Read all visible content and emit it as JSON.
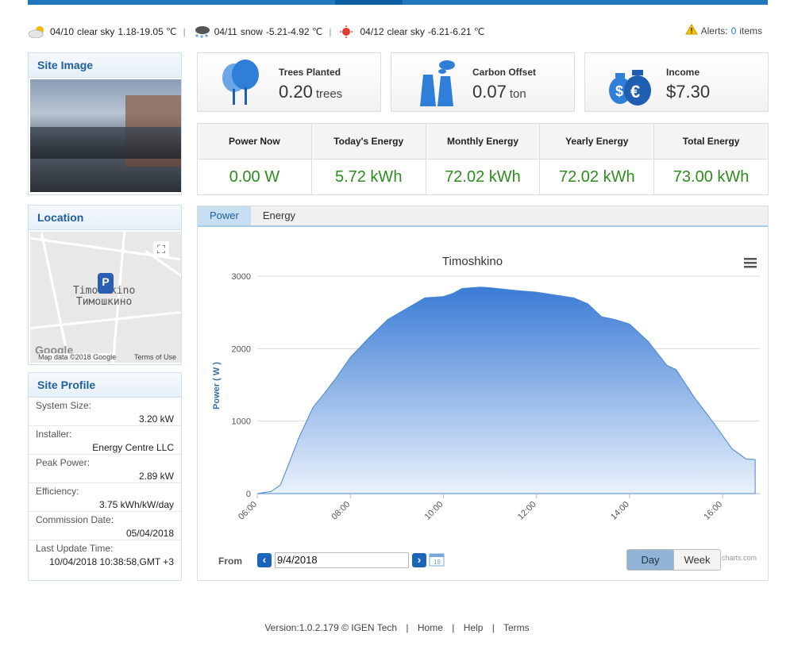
{
  "weather": [
    {
      "date": "04/10",
      "desc": "clear sky",
      "temp": "1.18-19.05 ℃",
      "icon": "cloud-sun-icon"
    },
    {
      "date": "04/11",
      "desc": "snow",
      "temp": "-5.21-4.92 ℃",
      "icon": "snow-cloud-icon"
    },
    {
      "date": "04/12",
      "desc": "clear sky",
      "temp": "-6.21-6.21 ℃",
      "icon": "sun-icon"
    }
  ],
  "alerts": {
    "label": "Alerts:",
    "count": "0",
    "suffix": "items"
  },
  "site_image": {
    "title": "Site Image"
  },
  "location": {
    "title": "Location",
    "place_latin": "Timoshkino",
    "place_cyrillic": "Тимошкино",
    "pin": "P",
    "map_data": "Map data ©2018 Google",
    "terms": "Terms of Use",
    "google": "Google"
  },
  "site_profile": {
    "title": "Site Profile",
    "rows": [
      {
        "label": "System Size:",
        "value": "3.20 kW"
      },
      {
        "label": "Installer:",
        "value": "Energy Centre LLC"
      },
      {
        "label": "Peak Power:",
        "value": "2.89 kW"
      },
      {
        "label": "Efficiency:",
        "value": "3.75 kWh/kW/day"
      },
      {
        "label": "Commission Date:",
        "value": "05/04/2018"
      },
      {
        "label": "Last Update Time:",
        "value": "10/04/2018 10:38:58,GMT +3"
      }
    ]
  },
  "cards": [
    {
      "title": "Trees Planted",
      "value": "0.20",
      "unit": "trees",
      "icon": "trees-icon"
    },
    {
      "title": "Carbon Offset",
      "value": "0.07",
      "unit": "ton",
      "icon": "factory-icon"
    },
    {
      "title": "Income",
      "value": "$7.30",
      "unit": "",
      "icon": "money-bags-icon"
    }
  ],
  "energy": [
    {
      "label": "Power Now",
      "value": "0.00 W"
    },
    {
      "label": "Today's Energy",
      "value": "5.72 kWh"
    },
    {
      "label": "Monthly Energy",
      "value": "72.02 kWh"
    },
    {
      "label": "Yearly Energy",
      "value": "72.02 kWh"
    },
    {
      "label": "Total Energy",
      "value": "73.00 kWh"
    }
  ],
  "chart_tabs": {
    "power": "Power",
    "energy": "Energy"
  },
  "date_bar": {
    "from": "From",
    "date": "9/4/2018",
    "day": "Day",
    "week": "Week",
    "credits": "charts.com"
  },
  "colors": {
    "accent": "#1f77c0",
    "value_green": "#2e8b1e",
    "area_top": "#3a7bd5",
    "area_bottom": "#eaf2fb"
  },
  "chart_data": {
    "type": "area",
    "title": "Timoshkino",
    "ylabel": "Power ( W )",
    "xlabel": "",
    "ylim": [
      0,
      3000
    ],
    "yticks": [
      0,
      1000,
      2000,
      3000
    ],
    "xticks": [
      "06:00",
      "08:00",
      "10:00",
      "12:00",
      "14:00",
      "16:00"
    ],
    "x_hours": [
      6.0,
      6.3,
      6.5,
      6.9,
      7.2,
      7.4,
      7.7,
      8.0,
      8.4,
      8.8,
      9.2,
      9.6,
      10.0,
      10.2,
      10.4,
      10.6,
      10.8,
      11.0,
      11.3,
      11.6,
      12.0,
      12.4,
      12.8,
      13.1,
      13.4,
      13.7,
      14.0,
      14.4,
      14.8,
      15.0,
      15.4,
      15.8,
      16.2,
      16.5,
      16.7
    ],
    "y_values": [
      0,
      30,
      120,
      780,
      1190,
      1350,
      1600,
      1880,
      2150,
      2400,
      2550,
      2700,
      2720,
      2760,
      2830,
      2840,
      2850,
      2840,
      2820,
      2800,
      2780,
      2740,
      2700,
      2620,
      2440,
      2400,
      2340,
      2100,
      1770,
      1710,
      1320,
      980,
      620,
      480,
      470
    ],
    "grid": true,
    "legend": "none"
  }
}
